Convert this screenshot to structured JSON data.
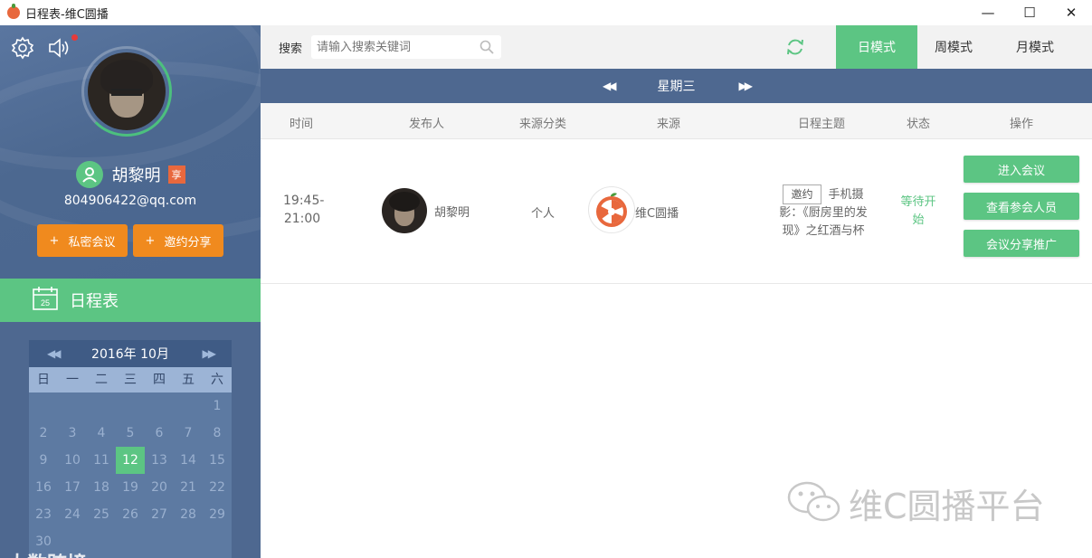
{
  "window": {
    "title": "日程表-维C圆播",
    "minimize": "—",
    "maximize": "☐",
    "close": "✕"
  },
  "sidebar": {
    "user": {
      "name": "胡黎明",
      "badge": "享",
      "email": "804906422@qq.com"
    },
    "buttons": [
      {
        "icon": "+",
        "label": "私密会议"
      },
      {
        "icon": "+",
        "label": "邀约分享"
      }
    ],
    "section_title": "日程表",
    "calendar": {
      "month_label": "2016年 10月",
      "weekdays": [
        "日",
        "一",
        "二",
        "三",
        "四",
        "五",
        "六"
      ],
      "days": [
        "",
        "",
        "",
        "",
        "",
        "",
        "1",
        "2",
        "3",
        "4",
        "5",
        "6",
        "7",
        "8",
        "9",
        "10",
        "11",
        "12",
        "13",
        "14",
        "15",
        "16",
        "17",
        "18",
        "19",
        "20",
        "21",
        "22",
        "23",
        "24",
        "25",
        "26",
        "27",
        "28",
        "29",
        "30"
      ],
      "selected_day": "12"
    },
    "watermark": "大数跨境"
  },
  "topbar": {
    "search_label": "搜索",
    "search_placeholder": "请输入搜索关键词",
    "modes": [
      "日模式",
      "周模式",
      "月模式"
    ],
    "active_mode": "日模式"
  },
  "daybar": {
    "day_label": "星期三"
  },
  "table": {
    "headers": {
      "time": "时间",
      "publisher": "发布人",
      "category": "来源分类",
      "source": "来源",
      "topic": "日程主题",
      "status": "状态",
      "actions": "操作"
    },
    "rows": [
      {
        "time_line1": "19:45-",
        "time_line2": "21:00",
        "publisher": "胡黎明",
        "category": "个人",
        "source": "维C圆播",
        "topic_tag": "邀约",
        "topic_line1": "手机摄",
        "topic_line2": "影：《厨房里的发",
        "topic_line3": "现》之红酒与杯",
        "status_line1": "等待开",
        "status_line2": "始",
        "actions": [
          "进入会议",
          "查看参会人员",
          "会议分享推广"
        ]
      }
    ]
  },
  "watermark_right": "维C圆播平台",
  "colors": {
    "sidebar": "#4e6890",
    "accent_green": "#5cc583",
    "accent_orange": "#f08a1e"
  }
}
